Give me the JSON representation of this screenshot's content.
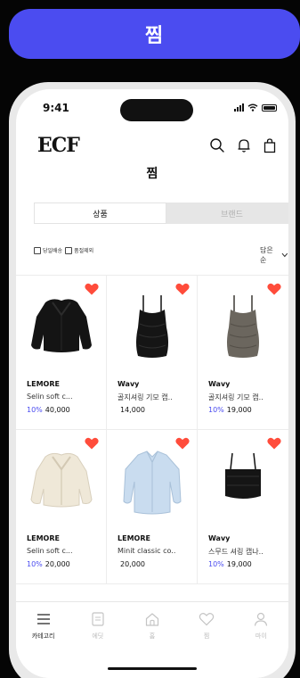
{
  "banner": {
    "title": "찜"
  },
  "status": {
    "time": "9:41"
  },
  "header": {
    "logo": "ECF",
    "title": "찜"
  },
  "tabs": [
    {
      "label": "상품",
      "active": true
    },
    {
      "label": "브랜드",
      "active": false
    }
  ],
  "filters": [
    {
      "label": "당일배송",
      "checked": false
    },
    {
      "label": "품절제외",
      "checked": false
    }
  ],
  "sort": {
    "label": "담은순"
  },
  "colors": {
    "accent": "#4b4cf0",
    "heart": "#ff4c3b"
  },
  "products": [
    {
      "brand": "LEMORE",
      "name": "Selin soft c...",
      "discount": "10%",
      "price": "40,000",
      "image": "black-fur-jacket"
    },
    {
      "brand": "Wavy",
      "name": "골지셔링 기모 캡..",
      "discount": "",
      "price": "14,000",
      "image": "black-camisole"
    },
    {
      "brand": "Wavy",
      "name": "골지셔링 기모 캡..",
      "discount": "10%",
      "price": "19,000",
      "image": "gray-camisole"
    },
    {
      "brand": "LEMORE",
      "name": "Selin soft c...",
      "discount": "10%",
      "price": "20,000",
      "image": "cream-fur-jacket"
    },
    {
      "brand": "LEMORE",
      "name": "Minit classic co..",
      "discount": "",
      "price": "20,000",
      "image": "light-blue-shirt"
    },
    {
      "brand": "Wavy",
      "name": "스무드 셔링 캡나..",
      "discount": "10%",
      "price": "19,000",
      "image": "black-bustier-top"
    }
  ],
  "bottom_nav": [
    {
      "label": "카테고리",
      "icon": "menu-icon",
      "active": true
    },
    {
      "label": "에딧",
      "icon": "edit-icon",
      "active": false
    },
    {
      "label": "홈",
      "icon": "home-icon",
      "active": false
    },
    {
      "label": "찜",
      "icon": "heart-icon",
      "active": false
    },
    {
      "label": "마이",
      "icon": "person-icon",
      "active": false
    }
  ]
}
